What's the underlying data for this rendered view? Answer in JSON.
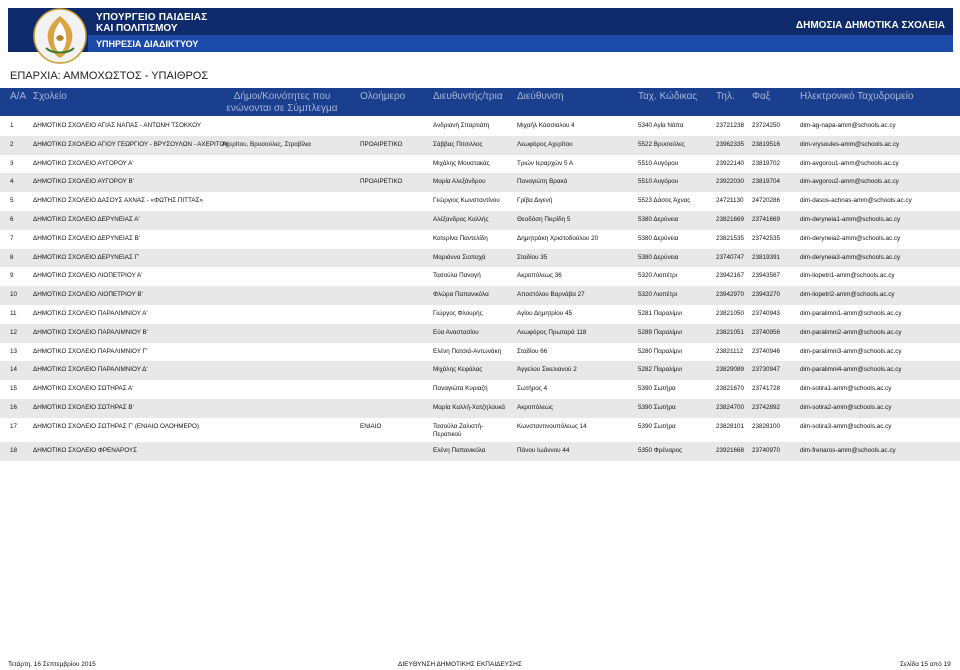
{
  "header": {
    "line1": "ΥΠΟΥΡΓΕΙΟ ΠΑΙΔΕΙΑΣ",
    "line2": "ΚΑΙ ΠΟΛΙΤΙΣΜΟΥ",
    "line3": "ΥΠΗΡΕΣΙΑ ΔΙΑΔΙΚΤΥΟΥ",
    "right": "ΔΗΜΟΣΙΑ ΔΗΜΟΤΙΚΑ ΣΧΟΛΕΙΑ"
  },
  "title": "ΕΠΑΡΧΙΑ: ΑΜΜΟΧΩΣΤΟΣ - ΥΠΑΙΘΡΟΣ",
  "columns": {
    "aa": "Α/Α",
    "school": "Σχολείο",
    "municipalities": "Δήμοι/Κοινότητες που ενώνονται σε Σύμπλεγμα",
    "allday": "Ολοήμερο",
    "principal": "Διευθυντής/τρια",
    "address": "Διεύθυνση",
    "postal": "Ταχ. Κώδικας",
    "phone": "Τηλ.",
    "fax": "Φαξ",
    "email": "Ηλεκτρονικό Ταχυδρομείο"
  },
  "rows": [
    {
      "aa": "1",
      "school": "ΔΗΜΟΤΙΚΟ ΣΧΟΛΕΙΟ ΑΓΙΑΣ ΝΑΠΑΣ - ΑΝΤΩΝΗ ΤΣΟΚΚΟΥ",
      "municipalities": "",
      "allday": "",
      "principal": "Ανδριανή Σπαρτιάτη",
      "address": "Μιχαήλ Κάσσιαλου 4",
      "postal": "5340 Αγία Νάπα",
      "phone": "23721238",
      "fax": "23724250",
      "email": "dim-ag-napa-amm@schools.ac.cy"
    },
    {
      "aa": "2",
      "school": "ΔΗΜΟΤΙΚΟ ΣΧΟΛΕΙΟ ΑΓΙΟΥ ΓΕΩΡΓΙΟΥ - ΒΡΥΣΟΥΛΩΝ - ΑΧΕΡΙΤΟΥ",
      "municipalities": "Αχερίτου, Βρυσούλες, Στροβίλια",
      "allday": "ΠΡΟΑΙΡΕΤΙΚΟ",
      "principal": "Σάββας Πιτσιλλος",
      "address": "Λεωφόρος Αχερίτου",
      "postal": "5522 Βρυσούλες",
      "phone": "23962335",
      "fax": "23819516",
      "email": "dim-vrysoules-amm@schools.ac.cy"
    },
    {
      "aa": "3",
      "school": "ΔΗΜΟΤΙΚΟ ΣΧΟΛΕΙΟ ΑΥΓΟΡΟΥ Α'",
      "municipalities": "",
      "allday": "",
      "principal": "Μιχάλης Μουστακάς",
      "address": "Τριών Ιεραρχών 5 Α",
      "postal": "5510 Αυγόρου",
      "phone": "23922140",
      "fax": "23819702",
      "email": "dim-avgorou1-amm@schools.ac.cy"
    },
    {
      "aa": "4",
      "school": "ΔΗΜΟΤΙΚΟ ΣΧΟΛΕΙΟ ΑΥΓΟΡΟΥ Β'",
      "municipalities": "",
      "allday": "ΠΡΟΑΙΡΕΤΙΚΟ",
      "principal": "Μαρία Αλεξάνδρου",
      "address": "Παναγιώτη Βρακά",
      "postal": "5510 Αυγόρου",
      "phone": "23922030",
      "fax": "23819704",
      "email": "dim-avgorou2-amm@schools.ac.cy"
    },
    {
      "aa": "5",
      "school": "ΔΗΜΟΤΙΚΟ ΣΧΟΛΕΙΟ ΔΑΣΟΥΣ ΑΧΝΑΣ - «ΦΩΤΗΣ ΠΙΤΤΑΣ»",
      "municipalities": "",
      "allday": "",
      "principal": "Γεώργιος Κωνσταντίνου",
      "address": "Γρίβα Διγενή",
      "postal": "5523 Δάσος Άχνας",
      "phone": "24721130",
      "fax": "24720286",
      "email": "dim-dasos-achnas-amm@schools.ac.cy"
    },
    {
      "aa": "6",
      "school": "ΔΗΜΟΤΙΚΟ ΣΧΟΛΕΙΟ ΔΕΡΥΝΕΙΑΣ Α'",
      "municipalities": "",
      "allday": "",
      "principal": "Αλέξανδρος Καλλής",
      "address": "Θεοδόση Πιερίδη 5",
      "postal": "5380 Δερύνεια",
      "phone": "23821669",
      "fax": "23741669",
      "email": "dim-deryneia1-amm@schools.ac.cy"
    },
    {
      "aa": "7",
      "school": "ΔΗΜΟΤΙΚΟ ΣΧΟΛΕΙΟ ΔΕΡΥΝΕΙΑΣ Β'",
      "municipalities": "",
      "allday": "",
      "principal": "Κατερίνα Παντελίδη",
      "address": "Δημητράκη Χριστοδούλου 20",
      "postal": "5380 Δερύνεια",
      "phone": "23821535",
      "fax": "23742535",
      "email": "dim-deryneia2-amm@schools.ac.cy"
    },
    {
      "aa": "8",
      "school": "ΔΗΜΟΤΙΚΟ ΣΧΟΛΕΙΟ ΔΕΡΥΝΕΙΑΣ Γ'",
      "municipalities": "",
      "allday": "",
      "principal": "Μαριάννα Σιοπαχά",
      "address": "Σταδίου 35",
      "postal": "5380 Δερύνεια",
      "phone": "23740747",
      "fax": "23819391",
      "email": "dim-deryneia3-amm@schools.ac.cy"
    },
    {
      "aa": "9",
      "school": "ΔΗΜΟΤΙΚΟ ΣΧΟΛΕΙΟ ΛΙΟΠΕΤΡΙΟΥ Α'",
      "municipalities": "",
      "allday": "",
      "principal": "Τασούλα Παναγή",
      "address": "Ακροπόλεως 36",
      "postal": "5320 Λιοπέτρι",
      "phone": "23942167",
      "fax": "23943567",
      "email": "dim-liopetri1-amm@schools.ac.cy"
    },
    {
      "aa": "10",
      "school": "ΔΗΜΟΤΙΚΟ ΣΧΟΛΕΙΟ ΛΙΟΠΕΤΡΙΟΥ Β'",
      "municipalities": "",
      "allday": "",
      "principal": "Φλώρα Παπανικόλα",
      "address": "Αποστόλου Βαρνάβα 27",
      "postal": "5320 Λιοπέτρι",
      "phone": "23942970",
      "fax": "23943270",
      "email": "dim-liopetri2-amm@schools.ac.cy"
    },
    {
      "aa": "11",
      "school": "ΔΗΜΟΤΙΚΟ ΣΧΟΛΕΙΟ ΠΑΡΑΛΙΜΝΙΟΥ Α'",
      "municipalities": "",
      "allday": "",
      "principal": "Γιώργος Φλουρής",
      "address": "Αγίου Δημητρίου 45",
      "postal": "5281 Παραλίμνι",
      "phone": "23821050",
      "fax": "23740943",
      "email": "dim-paralimni1-amm@schools.ac.cy"
    },
    {
      "aa": "12",
      "school": "ΔΗΜΟΤΙΚΟ ΣΧΟΛΕΙΟ ΠΑΡΑΛΙΜΝΙΟΥ Β'",
      "municipalities": "",
      "allday": "",
      "principal": "Εύα Αναστασίου",
      "address": "Λεωφόρος Πρωταρά 118",
      "postal": "5289 Παραλίμνι",
      "phone": "23821051",
      "fax": "23740956",
      "email": "dim-paralimni2-amm@schools.ac.cy"
    },
    {
      "aa": "13",
      "school": "ΔΗΜΟΤΙΚΟ ΣΧΟΛΕΙΟ ΠΑΡΑΛΙΜΝΙΟΥ Γ'",
      "municipalities": "",
      "allday": "",
      "principal": "Ελένη Πατσιά-Αντωνάκη",
      "address": "Σταδίου 66",
      "postal": "5280 Παραλίμνι",
      "phone": "23821112",
      "fax": "23740946",
      "email": "dim-paralimni3-amm@schools.ac.cy"
    },
    {
      "aa": "14",
      "school": "ΔΗΜΟΤΙΚΟ ΣΧΟΛΕΙΟ ΠΑΡΑΛΙΜΝΙΟΥ Δ'",
      "municipalities": "",
      "allday": "",
      "principal": "Μιχάλης Κεφάλας",
      "address": "Άγγελου Σικελιανού 2",
      "postal": "5282 Παραλίμνι",
      "phone": "23829089",
      "fax": "23730947",
      "email": "dim-paralimni4-amm@schools.ac.cy"
    },
    {
      "aa": "15",
      "school": "ΔΗΜΟΤΙΚΟ ΣΧΟΛΕΙΟ ΣΩΤΗΡΑΣ Α'",
      "municipalities": "",
      "allday": "",
      "principal": "Παναγιώτα Κυριαζή",
      "address": "Σωτήρος 4",
      "postal": "5390 Σωτήρα",
      "phone": "23821670",
      "fax": "23741728",
      "email": "dim-sotira1-amm@schools.ac.cy"
    },
    {
      "aa": "16",
      "school": "ΔΗΜΟΤΙΚΟ ΣΧΟΛΕΙΟ ΣΩΤΗΡΑΣ Β'",
      "municipalities": "",
      "allday": "",
      "principal": "Μαρία Καλλή-Χατζηλουκά",
      "address": "Ακροπόλεως",
      "postal": "5390 Σωτήρα",
      "phone": "23824700",
      "fax": "23742892",
      "email": "dim-sotira2-amm@schools.ac.cy"
    },
    {
      "aa": "17",
      "school": "ΔΗΜΟΤΙΚΟ ΣΧΟΛΕΙΟ ΣΩΤΗΡΑΣ Γ' (ΕΝΙΑΙΟ ΟΛΟΗΜΕΡΟ)",
      "municipalities": "",
      "allday": "ΕΝΙΑΙΟ",
      "principal": "Τασούλα Ζαλιστή-Περατικού",
      "address": "Κωνσταντινουπόλεως 14",
      "postal": "5390 Σωτήρα",
      "phone": "23828101",
      "fax": "23828100",
      "email": "dim-sotira3-amm@schools.ac.cy"
    },
    {
      "aa": "18",
      "school": "ΔΗΜΟΤΙΚΟ ΣΧΟΛΕΙΟ ΦΡΕΝΑΡΟΥΣ",
      "municipalities": "",
      "allday": "",
      "principal": "Ελένη Παπανικόλα",
      "address": "Πάνου Ιωάννου 44",
      "postal": "5350 Φρέναρος",
      "phone": "23921668",
      "fax": "23740970",
      "email": "dim-frenaros-amm@schools.ac.cy"
    }
  ],
  "footer": {
    "date": "Τετάρτη, 16 Σεπτεμβρίου 2015",
    "center": "ΔΙΕΥΘΥΝΣΗ ΔΗΜΟΤΙΚΗΣ ΕΚΠΑΙΔΕΥΣΗΣ",
    "page": "Σελίδα 15 από 19"
  },
  "colors": {
    "header_dark": "#0e2a6b",
    "header_band": "#1b4aa8",
    "table_header": "#1a3f8f",
    "row_alt": "#e8e8e8"
  }
}
